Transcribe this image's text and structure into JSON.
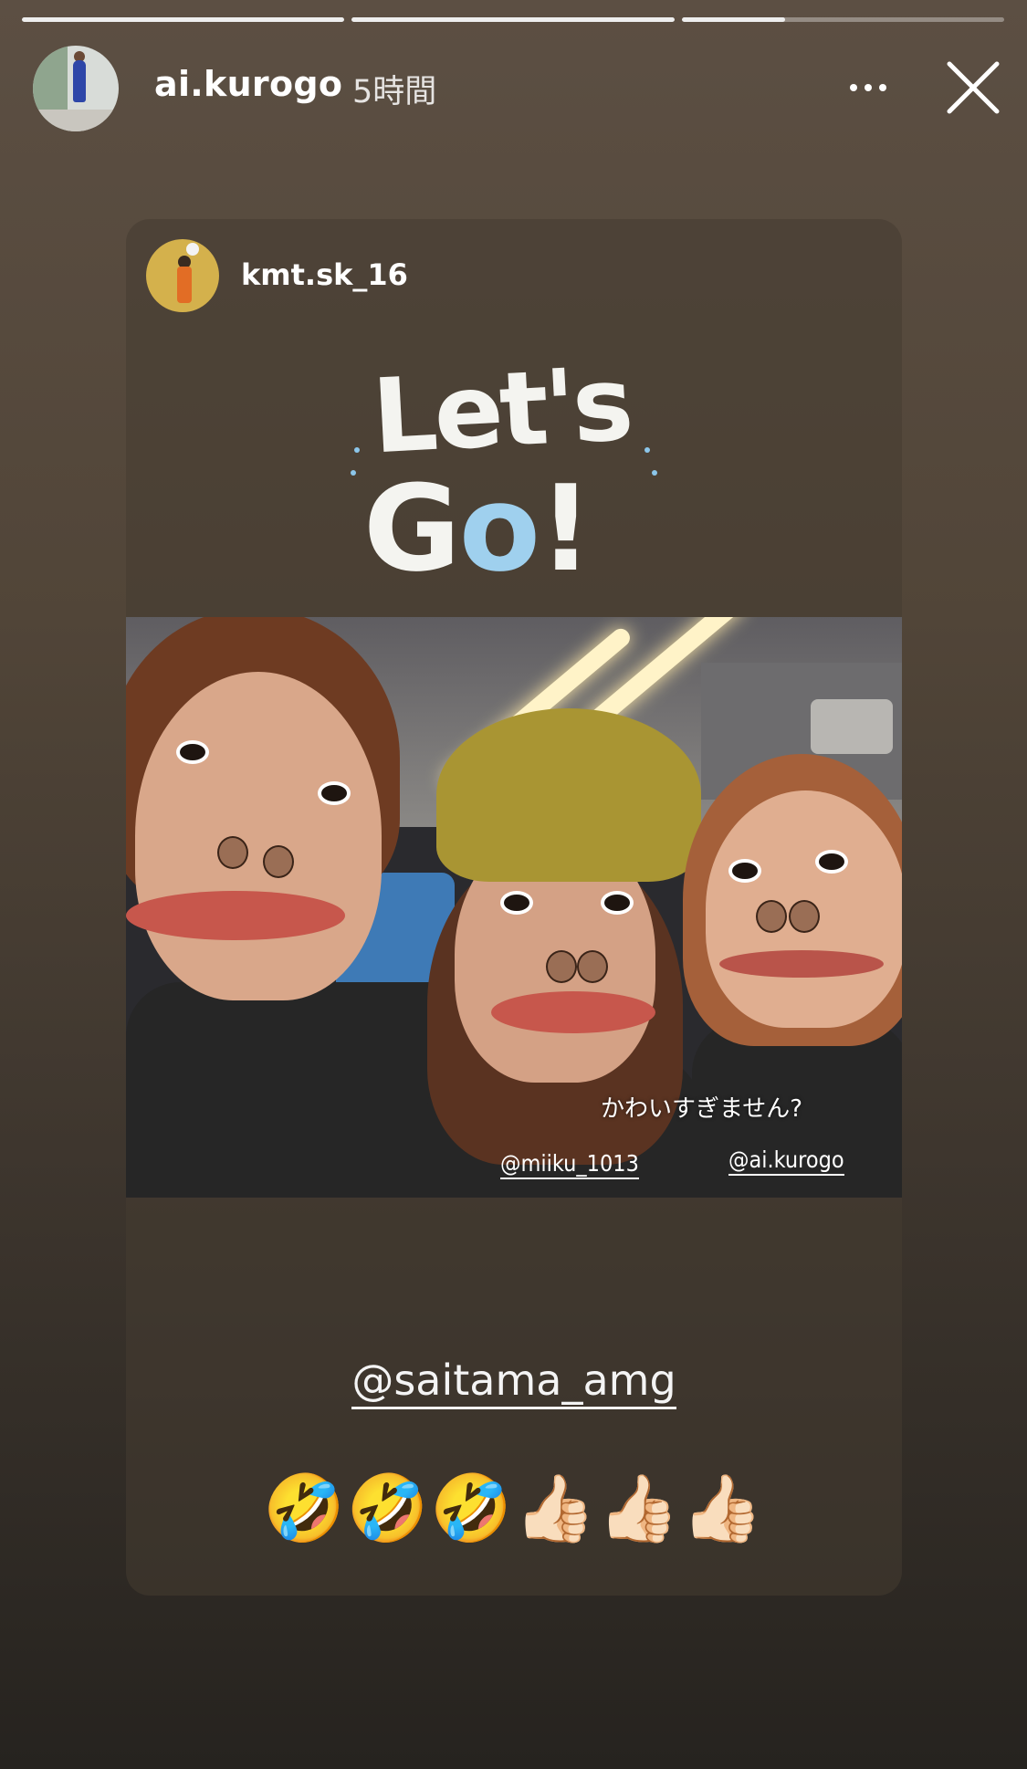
{
  "progress": {
    "segments": [
      1,
      1,
      0.32
    ]
  },
  "header": {
    "username": "ai.kurogo",
    "time": "5時間",
    "more_icon": "more-horizontal-icon",
    "close_icon": "close-icon"
  },
  "shared_post": {
    "username": "kmt.sk_16",
    "sticker_line1": "Let's",
    "sticker_line2_a": "G",
    "sticker_line2_o": "o",
    "sticker_line2_b": "!",
    "photo_caption": "かわいすぎません?",
    "photo_mention_1": "@miiku_1013",
    "photo_mention_2": "@ai.kurogo",
    "mention": "@saitama_amg",
    "emojis": "🤣🤣🤣👍🏻👍🏻👍🏻"
  },
  "colors": {
    "accent_blue": "#9fd0ee",
    "background_top": "#5c4f43",
    "background_bottom": "#26231f"
  }
}
